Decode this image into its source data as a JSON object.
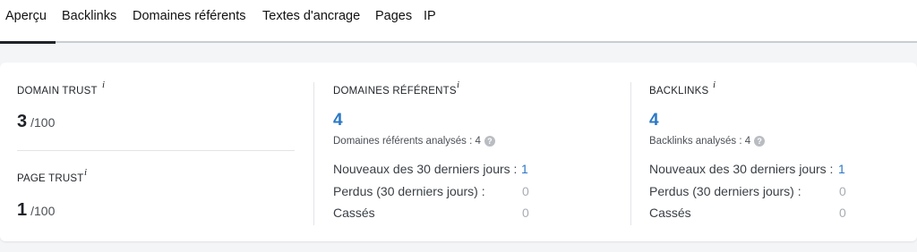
{
  "tabs": [
    {
      "label": "Aperçu",
      "active": true
    },
    {
      "label": "Backlinks",
      "active": false
    },
    {
      "label": "Domaines référents",
      "active": false
    },
    {
      "label": "Textes d'ancrage",
      "active": false
    },
    {
      "label": "Pages",
      "active": false
    },
    {
      "label": "IP",
      "active": false
    }
  ],
  "info_glyph": "i",
  "help_glyph": "?",
  "domain_trust": {
    "label": "DOMAIN TRUST",
    "value": "3",
    "suffix": "/100"
  },
  "page_trust": {
    "label": "PAGE TRUST",
    "value": "1",
    "suffix": "/100"
  },
  "referring_domains": {
    "label": "DOMAINES RÉFÉRENTS",
    "value": "4",
    "analyzed": "Domaines référents analysés : 4",
    "rows": [
      {
        "label": "Nouveaux des 30 derniers jours :",
        "value": "1"
      },
      {
        "label": "Perdus (30 derniers jours) :",
        "value": "0"
      },
      {
        "label": "Cassés",
        "value": "0"
      }
    ]
  },
  "backlinks": {
    "label": "BACKLINKS",
    "value": "4",
    "analyzed": "Backlinks analysés : 4",
    "rows": [
      {
        "label": "Nouveaux des 30 derniers jours :",
        "value": "1"
      },
      {
        "label": "Perdus (30 derniers jours) :",
        "value": "0"
      },
      {
        "label": "Cassés",
        "value": "0"
      }
    ]
  },
  "colors": {
    "accent": "#2b78c6",
    "muted": "#a8adb3",
    "text": "#1f2328"
  }
}
